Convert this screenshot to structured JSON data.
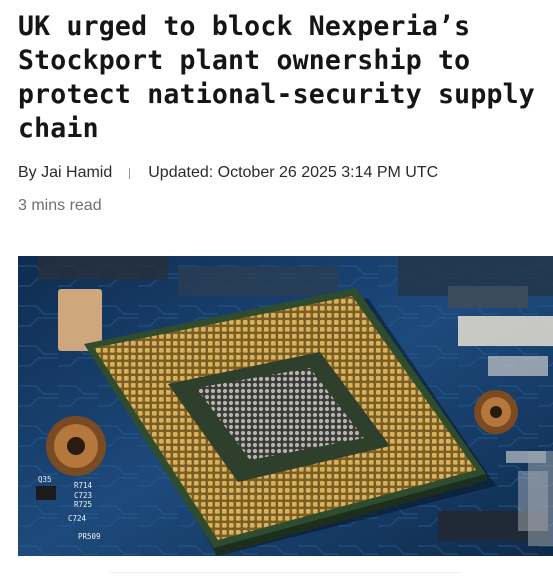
{
  "article": {
    "headline": "UK urged to block Nexperia’s Stockport plant ownership to protect national-security supply chain",
    "byline": {
      "author": "By Jai Hamid",
      "updated": "Updated: October 26 2025 3:14 PM UTC"
    },
    "read_time": "3 mins read"
  },
  "hero_image": {
    "board_labels": [
      "Q35",
      "R714",
      "C723",
      "R725",
      "C724",
      "PR509"
    ],
    "colors": {
      "board": "#1b3f6b",
      "chip_pads": "#c9a24a",
      "chip_substrate": "#2e4a2f"
    }
  }
}
